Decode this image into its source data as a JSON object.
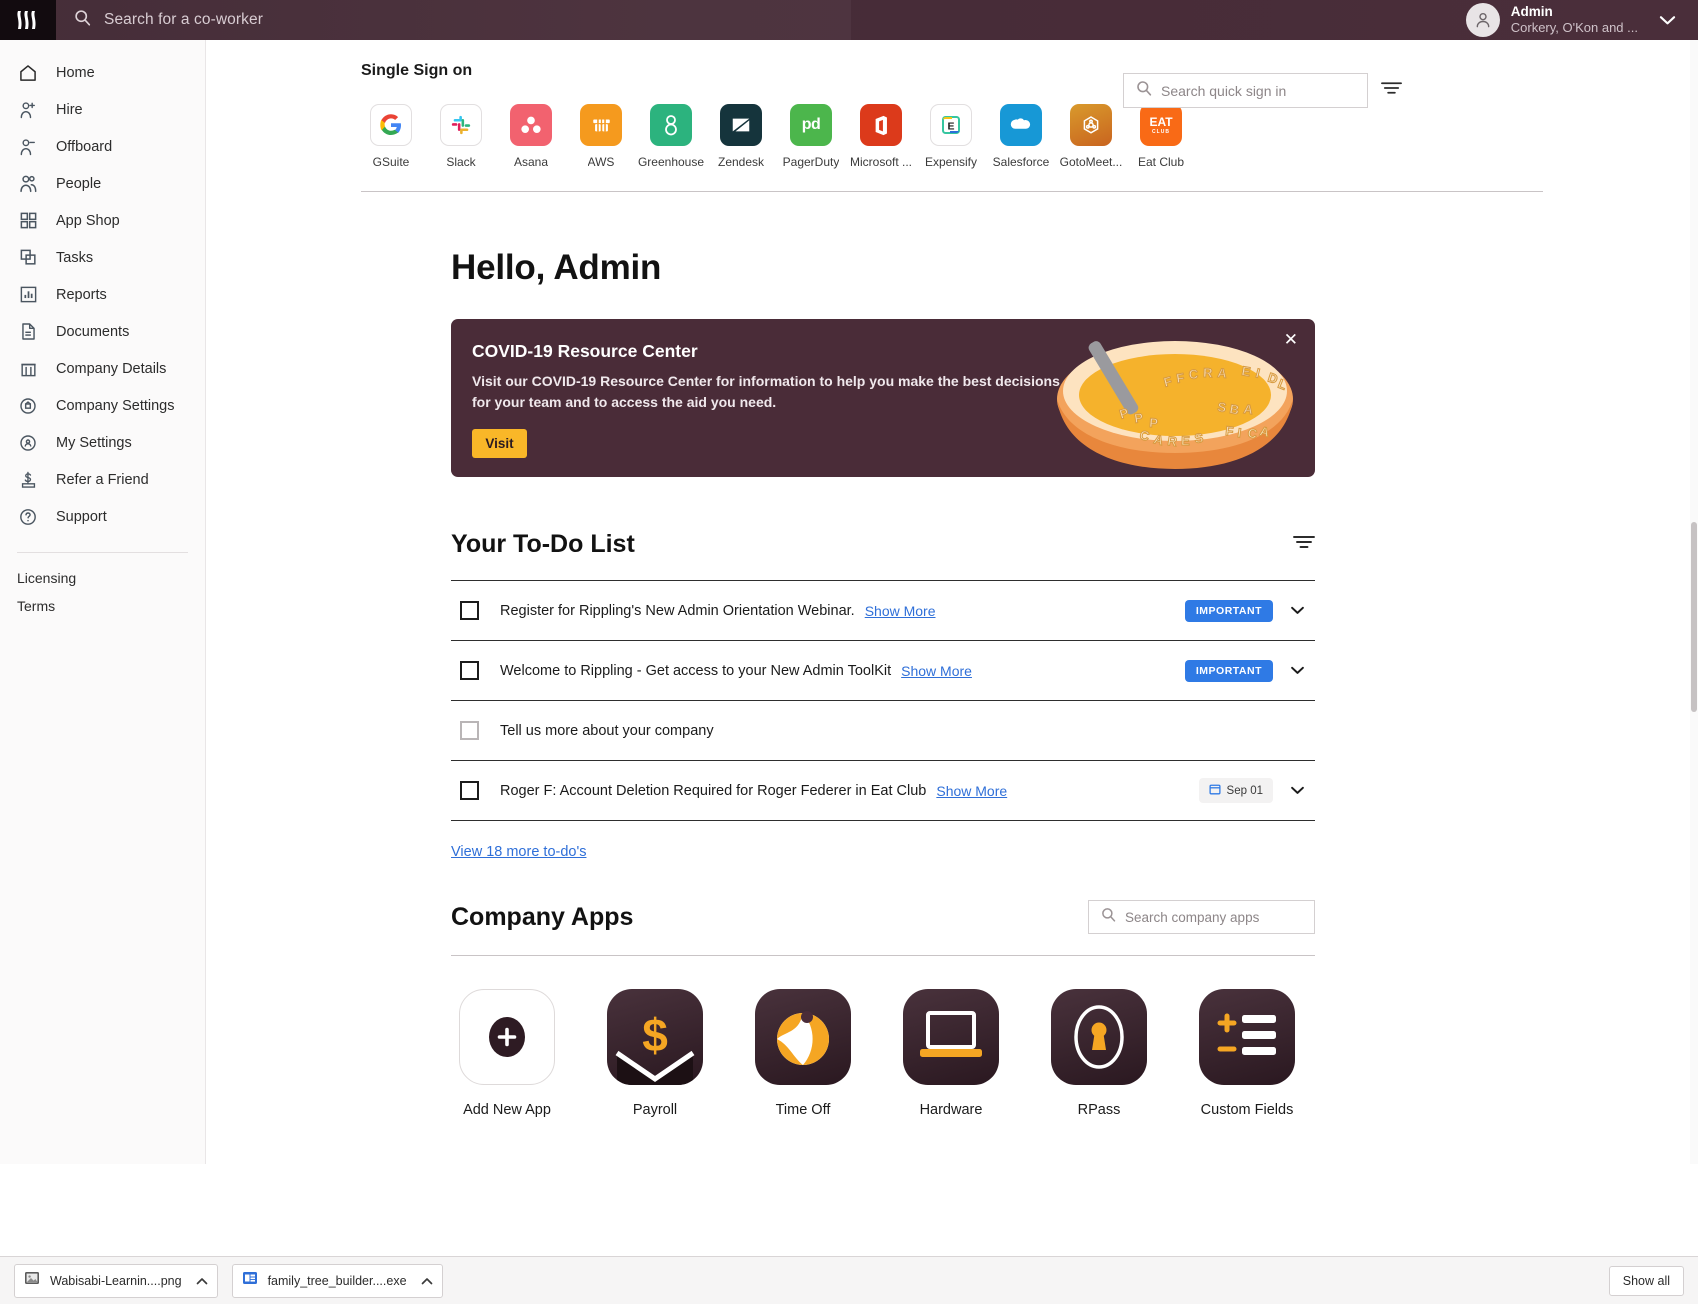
{
  "topbar": {
    "brand_icon": "rippling-logo-icon",
    "search": {
      "icon": "search-icon",
      "placeholder": "Search for a co-worker",
      "value": ""
    },
    "user": {
      "name": "Admin",
      "org": "Corkery, O'Kon and ...",
      "avatar_icon": "person-avatar-icon",
      "caret_icon": "chevron-down-icon"
    }
  },
  "sidebar": {
    "items": [
      {
        "label": "Home",
        "icon": "home-icon"
      },
      {
        "label": "Hire",
        "icon": "person-plus-icon"
      },
      {
        "label": "Offboard",
        "icon": "person-minus-icon"
      },
      {
        "label": "People",
        "icon": "people-icon"
      },
      {
        "label": "App Shop",
        "icon": "grid-apps-icon"
      },
      {
        "label": "Tasks",
        "icon": "tasks-stack-icon"
      },
      {
        "label": "Reports",
        "icon": "bar-chart-icon"
      },
      {
        "label": "Documents",
        "icon": "document-icon"
      },
      {
        "label": "Company Details",
        "icon": "building-icon"
      },
      {
        "label": "Company Settings",
        "icon": "gear-company-icon"
      },
      {
        "label": "My Settings",
        "icon": "gear-person-icon"
      },
      {
        "label": "Refer a Friend",
        "icon": "dollar-referral-icon"
      },
      {
        "label": "Support",
        "icon": "question-circle-icon"
      }
    ],
    "footer_links": [
      {
        "label": "Licensing"
      },
      {
        "label": "Terms"
      }
    ]
  },
  "sso": {
    "title": "Single Sign on",
    "search": {
      "icon": "search-icon",
      "placeholder": "Search quick sign in",
      "value": ""
    },
    "filter_icon": "filter-icon",
    "apps": [
      {
        "name": "GSuite",
        "bg": "#ffffff",
        "style": "outline"
      },
      {
        "name": "Slack",
        "bg": "#ffffff",
        "style": "outline"
      },
      {
        "name": "Asana",
        "bg": "#f2626f",
        "style": "solid"
      },
      {
        "name": "AWS",
        "bg": "#f59a1e",
        "style": "solid"
      },
      {
        "name": "Greenhouse",
        "bg": "#2cb37e",
        "style": "solid"
      },
      {
        "name": "Zendesk",
        "bg": "#15343c",
        "style": "solid"
      },
      {
        "name": "PagerDuty",
        "bg": "#4cb64c",
        "style": "solid"
      },
      {
        "name": "Microsoft ...",
        "bg": "#dc3a1b",
        "style": "solid"
      },
      {
        "name": "Expensify",
        "bg": "#ffffff",
        "style": "outline"
      },
      {
        "name": "Salesforce",
        "bg": "#1798d6",
        "style": "solid"
      },
      {
        "name": "GotoMeet...",
        "bg": "#d68b26",
        "style": "solid"
      },
      {
        "name": "Eat Club",
        "bg": "#f96a16",
        "style": "solid"
      }
    ]
  },
  "greeting": "Hello, Admin",
  "banner": {
    "title": "COVID-19 Resource Center",
    "body": "Visit our COVID-19 Resource Center for information to help you make the best decisions for your team and to access the aid you need.",
    "button_label": "Visit",
    "close_icon": "close-icon",
    "art_icon": "alphabet-soup-bowl-icon",
    "bg_color": "#4a2c38",
    "button_color": "#f9b728"
  },
  "todo": {
    "title": "Your To-Do List",
    "filter_icon": "filter-icon",
    "view_more_label": "View 18 more to-do's",
    "items": [
      {
        "text": "Register for Rippling's New Admin Orientation Webinar.",
        "link": "Show More",
        "badge": "IMPORTANT",
        "date": "",
        "checkbox": "unchecked",
        "checkbox_style": "dark",
        "chevron_icon": "chevron-down-icon"
      },
      {
        "text": "Welcome to Rippling - Get access to your New Admin ToolKit",
        "link": "Show More",
        "badge": "IMPORTANT",
        "date": "",
        "checkbox": "unchecked",
        "checkbox_style": "dark",
        "chevron_icon": "chevron-down-icon"
      },
      {
        "text": "Tell us more about your company",
        "link": "",
        "badge": "",
        "date": "",
        "checkbox": "unchecked",
        "checkbox_style": "light",
        "chevron_icon": ""
      },
      {
        "text": "Roger F: Account Deletion Required for Roger Federer in Eat Club",
        "link": "Show More",
        "badge": "",
        "date": "Sep 01",
        "date_icon": "calendar-icon",
        "checkbox": "unchecked",
        "checkbox_style": "dark",
        "chevron_icon": "chevron-down-icon"
      }
    ],
    "badge_color": "#2f7ae5"
  },
  "company_apps": {
    "title": "Company Apps",
    "search": {
      "icon": "search-icon",
      "placeholder": "Search company apps",
      "value": ""
    },
    "apps": [
      {
        "name": "Add New App",
        "icon": "plus-circle-icon",
        "style": "outline"
      },
      {
        "name": "Payroll",
        "icon": "dollar-envelope-icon",
        "style": "dark"
      },
      {
        "name": "Time Off",
        "icon": "beach-ball-icon",
        "style": "dark"
      },
      {
        "name": "Hardware",
        "icon": "laptop-icon",
        "style": "dark"
      },
      {
        "name": "RPass",
        "icon": "keyhole-icon",
        "style": "dark"
      },
      {
        "name": "Custom Fields",
        "icon": "custom-fields-icon",
        "style": "dark"
      }
    ]
  },
  "taskbar": {
    "downloads": [
      {
        "label": "Wabisabi-Learnin....png",
        "icon": "image-file-icon",
        "caret_icon": "chevron-up-icon"
      },
      {
        "label": "family_tree_builder....exe",
        "icon": "exe-file-icon",
        "caret_icon": "chevron-up-icon"
      }
    ],
    "show_all_label": "Show all"
  }
}
